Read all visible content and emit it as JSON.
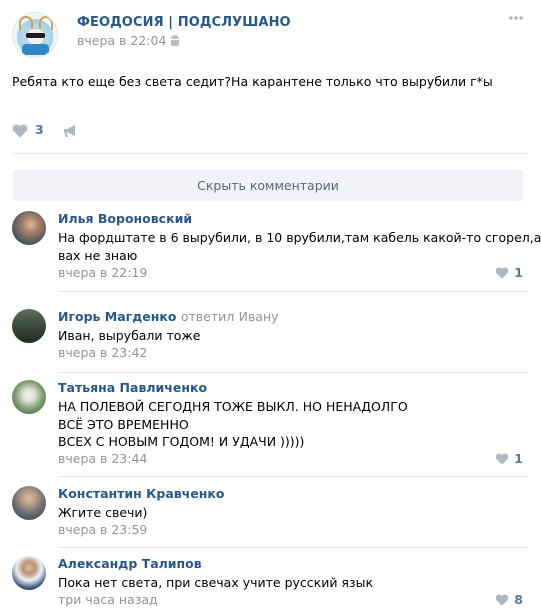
{
  "post": {
    "group_name": "ФЕОДОСИЯ | ПОДСЛУШАНО",
    "time": "вчера в 22:04",
    "text": "Ребята кто еще без света седит?На карантене только что вырубили г*ы",
    "likes": "3"
  },
  "comments_toggle": {
    "label": "Скрыть комментарии"
  },
  "comments": [
    {
      "author": "Илья Вороновский",
      "lines": [
        "На фордштате в 6 вырубили, в 10 врубили,там кабель какой-то сгорел,а у",
        "вах не знаю"
      ],
      "date": "вчера в 22:19",
      "likes": "1"
    },
    {
      "author": "Игорь Магденко",
      "replied": "ответил",
      "reply_to": "Ивану",
      "lines": [
        "Иван, вырубали тоже"
      ],
      "date": "вчера в 23:42",
      "likes": ""
    },
    {
      "author": "Татьяна Павличенко",
      "lines": [
        "НА ПОЛЕВОЙ СЕГОДНЯ ТОЖЕ ВЫКЛ. НО НЕНАДОЛГО",
        "ВСЁ ЭТО ВРЕМЕННО",
        "ВСЕХ С НОВЫМ ГОДОМ! И УДАЧИ )))))"
      ],
      "date": "вчера в 23:44",
      "likes": "1"
    },
    {
      "author": "Константин Кравченко",
      "lines": [
        "Жгите свечи)"
      ],
      "date": "вчера в 23:59",
      "likes": ""
    },
    {
      "author": "Александр Талипов",
      "lines": [
        "Пока нет света, при свечах учите русский язык"
      ],
      "date": "три часа назад",
      "likes": "8"
    }
  ],
  "icons": {
    "more": "more-horizontal-icon",
    "like": "heart-icon",
    "share": "megaphone-icon",
    "platform": "android-icon"
  },
  "colors": {
    "link": "#2a5885",
    "meta": "#939393",
    "icon": "#aeb7c2",
    "button_bg": "#f0f2f5"
  }
}
